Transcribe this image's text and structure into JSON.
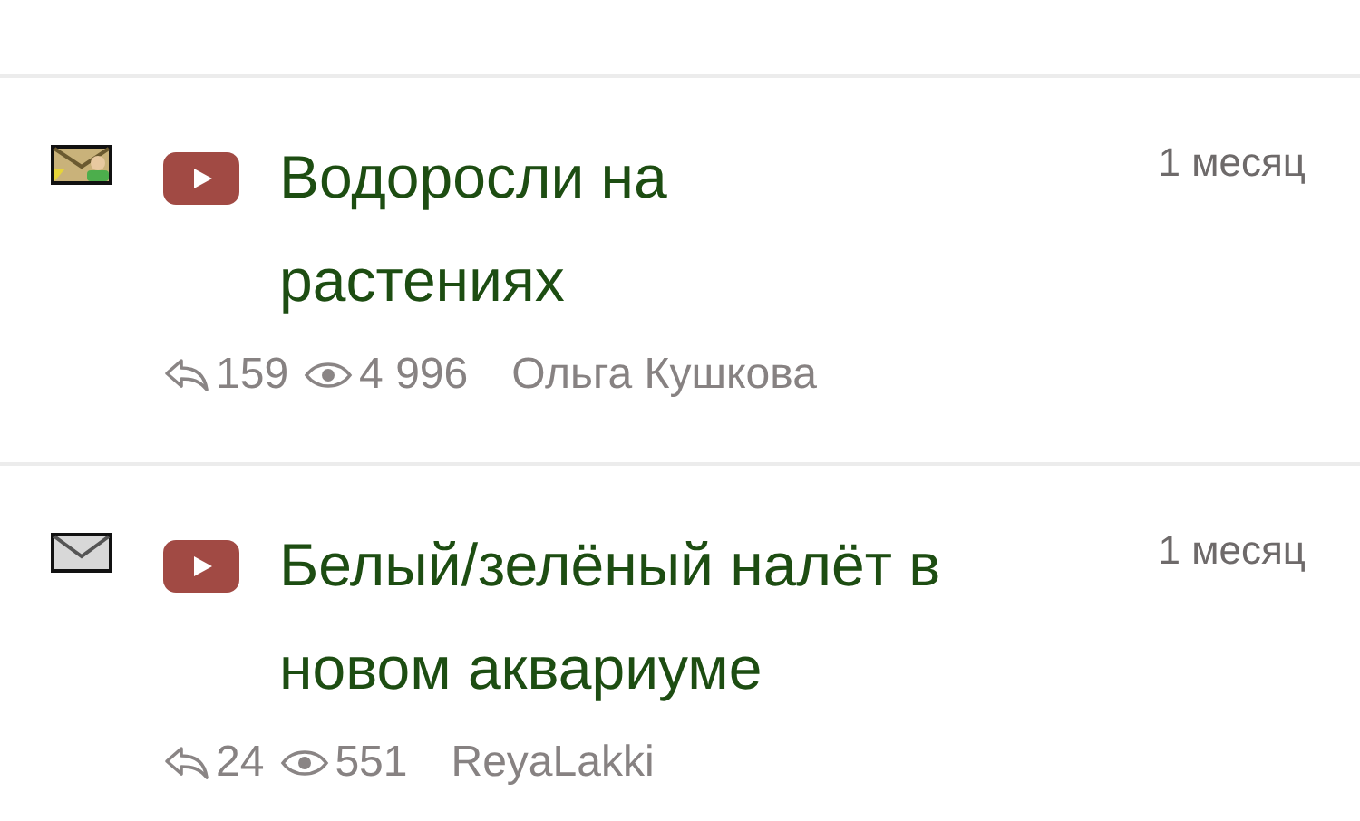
{
  "topics": [
    {
      "kind": "mail-user",
      "video": true,
      "title": "Водоросли на растениях",
      "age": "1 месяц",
      "replies": "159",
      "views": "4 996",
      "author": "Ольга Кушкова"
    },
    {
      "kind": "mail",
      "video": true,
      "title": "Белый/зелёный налёт в новом аквариуме",
      "age": "1 месяц",
      "replies": "24",
      "views": "551",
      "author": "ReyaLakki"
    }
  ]
}
